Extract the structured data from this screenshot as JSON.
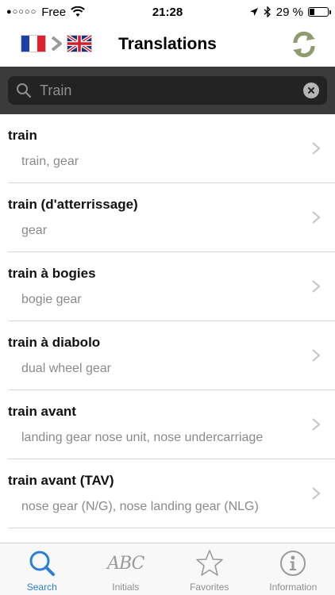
{
  "status_bar": {
    "carrier": "Free",
    "time": "21:28",
    "battery_text": "29 %",
    "battery_level": 0.29
  },
  "nav": {
    "title": "Translations",
    "source_flag": "france-flag-icon",
    "target_flag": "uk-flag-icon",
    "swap_icon": "swap-icon"
  },
  "search": {
    "value": "Train",
    "placeholder": "Train"
  },
  "results": [
    {
      "title": "train",
      "translation": "train, gear"
    },
    {
      "title": "train (d'atterrissage)",
      "translation": "gear"
    },
    {
      "title": "train à bogies",
      "translation": "bogie gear"
    },
    {
      "title": "train à diabolo",
      "translation": "dual wheel gear"
    },
    {
      "title": "train avant",
      "translation": "landing gear nose unit, nose undercarriage"
    },
    {
      "title": "train avant (TAV)",
      "translation": "nose gear (N/G), nose landing gear (NLG)"
    }
  ],
  "tabs": [
    {
      "label": "Search",
      "icon": "search-icon",
      "active": true
    },
    {
      "label": "Initials",
      "icon": "abc-icon",
      "abc_text": "ABC",
      "active": false
    },
    {
      "label": "Favorites",
      "icon": "star-icon",
      "active": false
    },
    {
      "label": "Information",
      "icon": "info-icon",
      "active": false
    }
  ],
  "colors": {
    "accent": "#2a7fd4",
    "search_bg": "#3b3b3b",
    "swap_icon": "#8f9a6e"
  }
}
